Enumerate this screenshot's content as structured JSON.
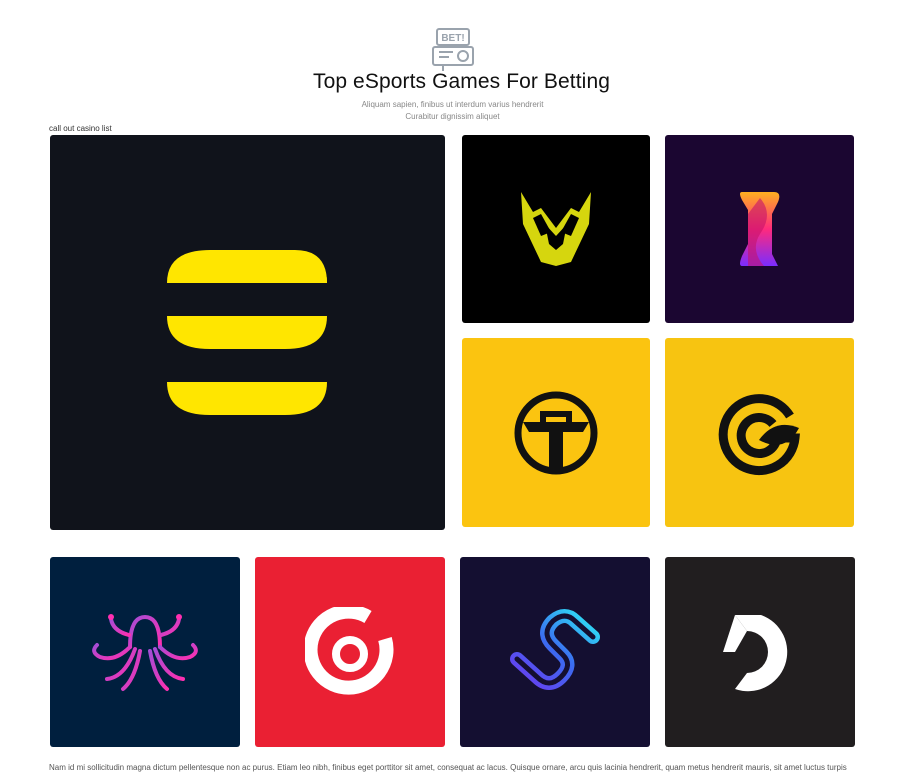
{
  "header": {
    "icon": "bet-ticket-icon",
    "title": "Top eSports Games For Betting",
    "subtitle_line1": "Aliquam sapien, finibus ut interdum varius hendrerit",
    "subtitle_line2": "Curabitur dignissim aliquet",
    "callout": "call out casino list"
  },
  "tiles": [
    {
      "name": "tile-yellow-s-logo",
      "icon": "striped-s-icon",
      "bg": "#10131b",
      "accent": "#ffe600"
    },
    {
      "name": "tile-crest-logo",
      "icon": "crest-icon",
      "bg": "#000000",
      "accent": "#d6d60e"
    },
    {
      "name": "tile-gradient-i-logo",
      "icon": "gradient-i-icon",
      "bg": "#1b0631",
      "accent": "#ff4c7d"
    },
    {
      "name": "tile-t-circle-logo",
      "icon": "t-circle-icon",
      "bg": "#fbc410",
      "accent": "#111111"
    },
    {
      "name": "tile-g-leaf-logo",
      "icon": "g-leaf-icon",
      "bg": "#f7c411",
      "accent": "#111111"
    },
    {
      "name": "tile-octopus-logo",
      "icon": "octopus-icon",
      "bg": "#001f3e",
      "accent": "#d43bd0"
    },
    {
      "name": "tile-target-logo",
      "icon": "target-icon",
      "bg": "#ea2033",
      "accent": "#ffffff"
    },
    {
      "name": "tile-neon-s-logo",
      "icon": "neon-s-icon",
      "bg": "#140f31",
      "accent": "#3b6cf0"
    },
    {
      "name": "tile-c-logo",
      "icon": "c-letter-icon",
      "bg": "#211e1f",
      "accent": "#ffffff"
    }
  ],
  "footer": {
    "text": "Nam id mi sollicitudin magna dictum pellentesque non ac purus. Etiam leo nibh, finibus eget porttitor sit amet, consequat ac lacus. Quisque ornare, arcu quis lacinia hendrerit, quam metus hendrerit mauris, sit amet luctus turpis"
  }
}
